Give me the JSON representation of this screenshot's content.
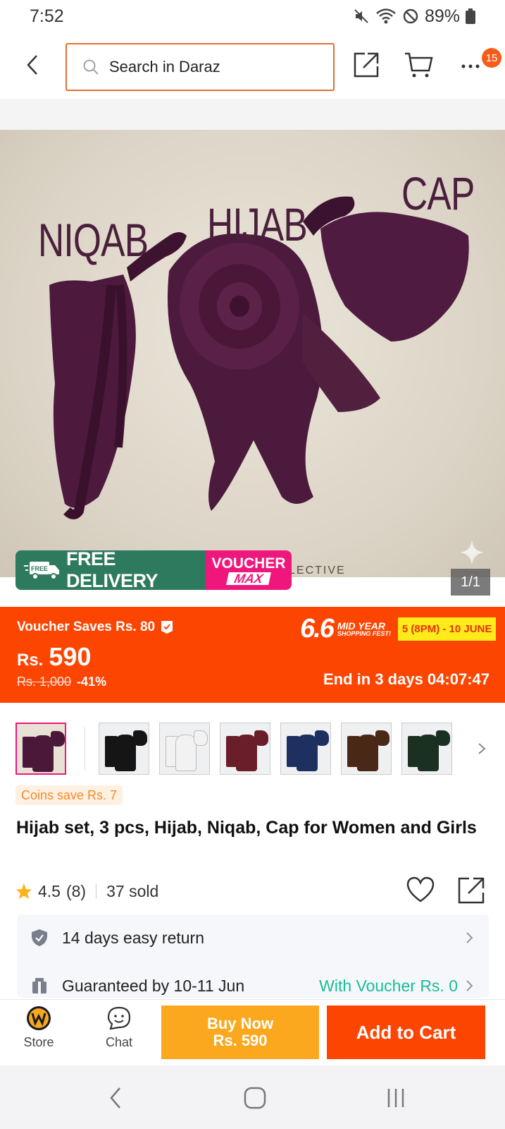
{
  "status_bar": {
    "time": "7:52",
    "battery": "89%"
  },
  "header": {
    "search_placeholder": "Search in Daraz",
    "more_badge_count": "15"
  },
  "product_image": {
    "label_niqab": "NIQAB",
    "label_hijab": "HIJAB",
    "label_cap": "CAP",
    "label_watermark": "LECTIVE",
    "page_indicator": "1/1",
    "free_delivery": "FREE DELIVERY",
    "free_icon_text": "FREE",
    "voucher_line1": "VOUCHER",
    "voucher_line2": "MAX"
  },
  "price_banner": {
    "voucher_saves": "Voucher Saves Rs. 80",
    "currency": "Rs.",
    "price": "590",
    "old_price": "Rs. 1,000",
    "discount": "-41%",
    "fest_number": "6.6",
    "fest_name_line1": "MID YEAR",
    "fest_name_line2": "SHOPPING FEST!",
    "fest_dates": "5 (8PM) - 10 JUNE",
    "countdown": "End in 3 days 04:07:47"
  },
  "variants": [
    {
      "color": "#4a1838"
    },
    {
      "color": "#151515"
    },
    {
      "color": "#f2f2f2"
    },
    {
      "color": "#6a1e2a"
    },
    {
      "color": "#1e3060"
    },
    {
      "color": "#4a2818"
    },
    {
      "color": "#1a3020"
    }
  ],
  "coins": "Coins save Rs. 7",
  "title": "Hijab set, 3 pcs, Hijab, Niqab, Cap for Women and Girls",
  "rating": {
    "score": "4.5",
    "count": "(8)",
    "sold": "37 sold"
  },
  "info": {
    "returns": "14 days easy return",
    "delivery": "Guaranteed by 10-11 Jun",
    "delivery_voucher": "With Voucher Rs. 0"
  },
  "action_bar": {
    "store_label": "Store",
    "chat_label": "Chat",
    "buy_now_line1": "Buy Now",
    "buy_now_line2": "Rs. 590",
    "add_to_cart": "Add to Cart"
  },
  "colors": {
    "brand_orange": "#fd4502",
    "buy_now_yellow": "#fca81e",
    "accent_teal": "#19bc9b",
    "voucher_pink": "#f0177c",
    "delivery_green": "#2e7a5e"
  }
}
